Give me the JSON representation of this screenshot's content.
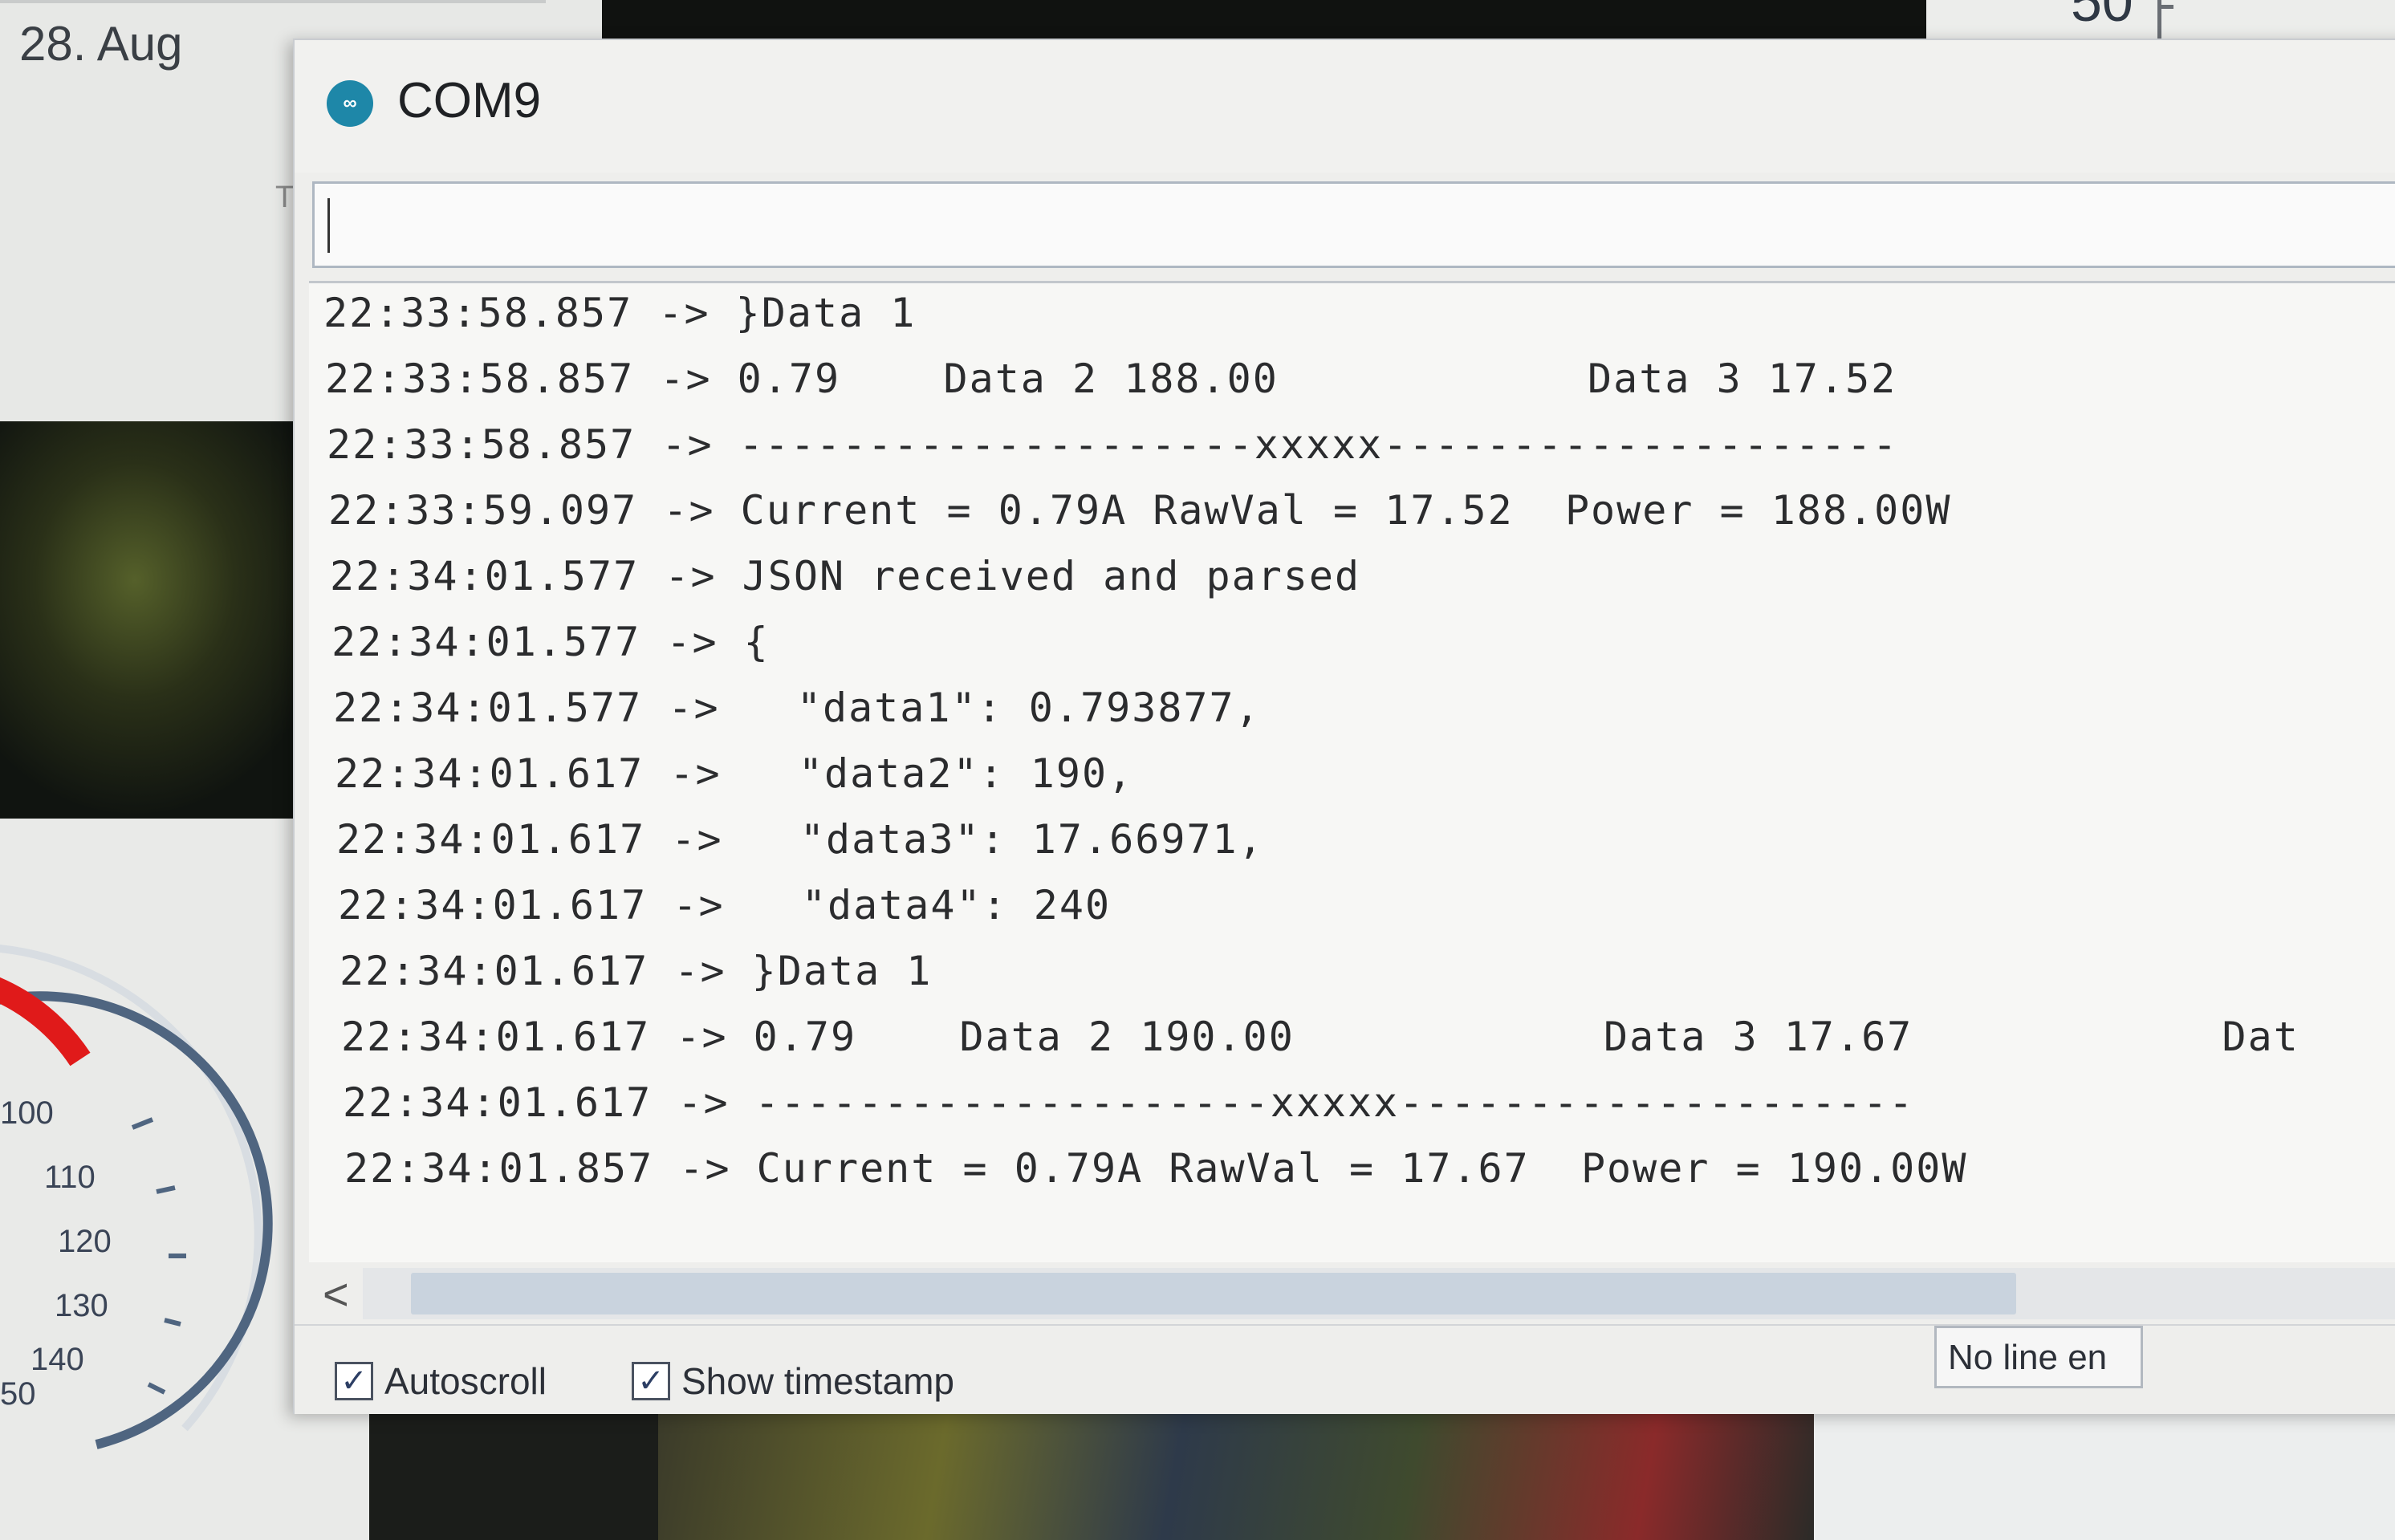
{
  "background": {
    "date_label": "28. Aug",
    "top_right_number": "50",
    "gauge_ticks": [
      "100",
      "110",
      "120",
      "130",
      "140",
      "50"
    ],
    "gauge_accent_color": "#e01a1a"
  },
  "window": {
    "title": "COM9",
    "icon": "arduino-icon"
  },
  "send_input": {
    "value": ""
  },
  "log": [
    {
      "time": "22:33:58.857",
      "text": "}Data 1"
    },
    {
      "time": "22:33:58.857",
      "text": "0.79    Data 2 188.00            Data 3 17.52"
    },
    {
      "time": "22:33:58.857",
      "text": "--------------------xxxxx--------------------"
    },
    {
      "time": "22:33:59.097",
      "text": "Current = 0.79A RawVal = 17.52  Power = 188.00W"
    },
    {
      "time": "22:34:01.577",
      "text": "JSON received and parsed"
    },
    {
      "time": "22:34:01.577",
      "text": "{"
    },
    {
      "time": "22:34:01.577",
      "text": "  \"data1\": 0.793877,"
    },
    {
      "time": "22:34:01.617",
      "text": "  \"data2\": 190,"
    },
    {
      "time": "22:34:01.617",
      "text": "  \"data3\": 17.66971,"
    },
    {
      "time": "22:34:01.617",
      "text": "  \"data4\": 240"
    },
    {
      "time": "22:34:01.617",
      "text": "}Data 1"
    },
    {
      "time": "22:34:01.617",
      "text": "0.79    Data 2 190.00            Data 3 17.67            Dat"
    },
    {
      "time": "22:34:01.617",
      "text": "--------------------xxxxx--------------------"
    },
    {
      "time": "22:34:01.857",
      "text": "Current = 0.79A RawVal = 17.67  Power = 190.00W"
    }
  ],
  "log_separator": "->",
  "scrollbar": {
    "left_arrow": "<"
  },
  "options": {
    "autoscroll": {
      "label": "Autoscroll",
      "checked": true
    },
    "show_timestamp": {
      "label": "Show timestamp",
      "checked": true
    },
    "line_ending": "No line en"
  }
}
